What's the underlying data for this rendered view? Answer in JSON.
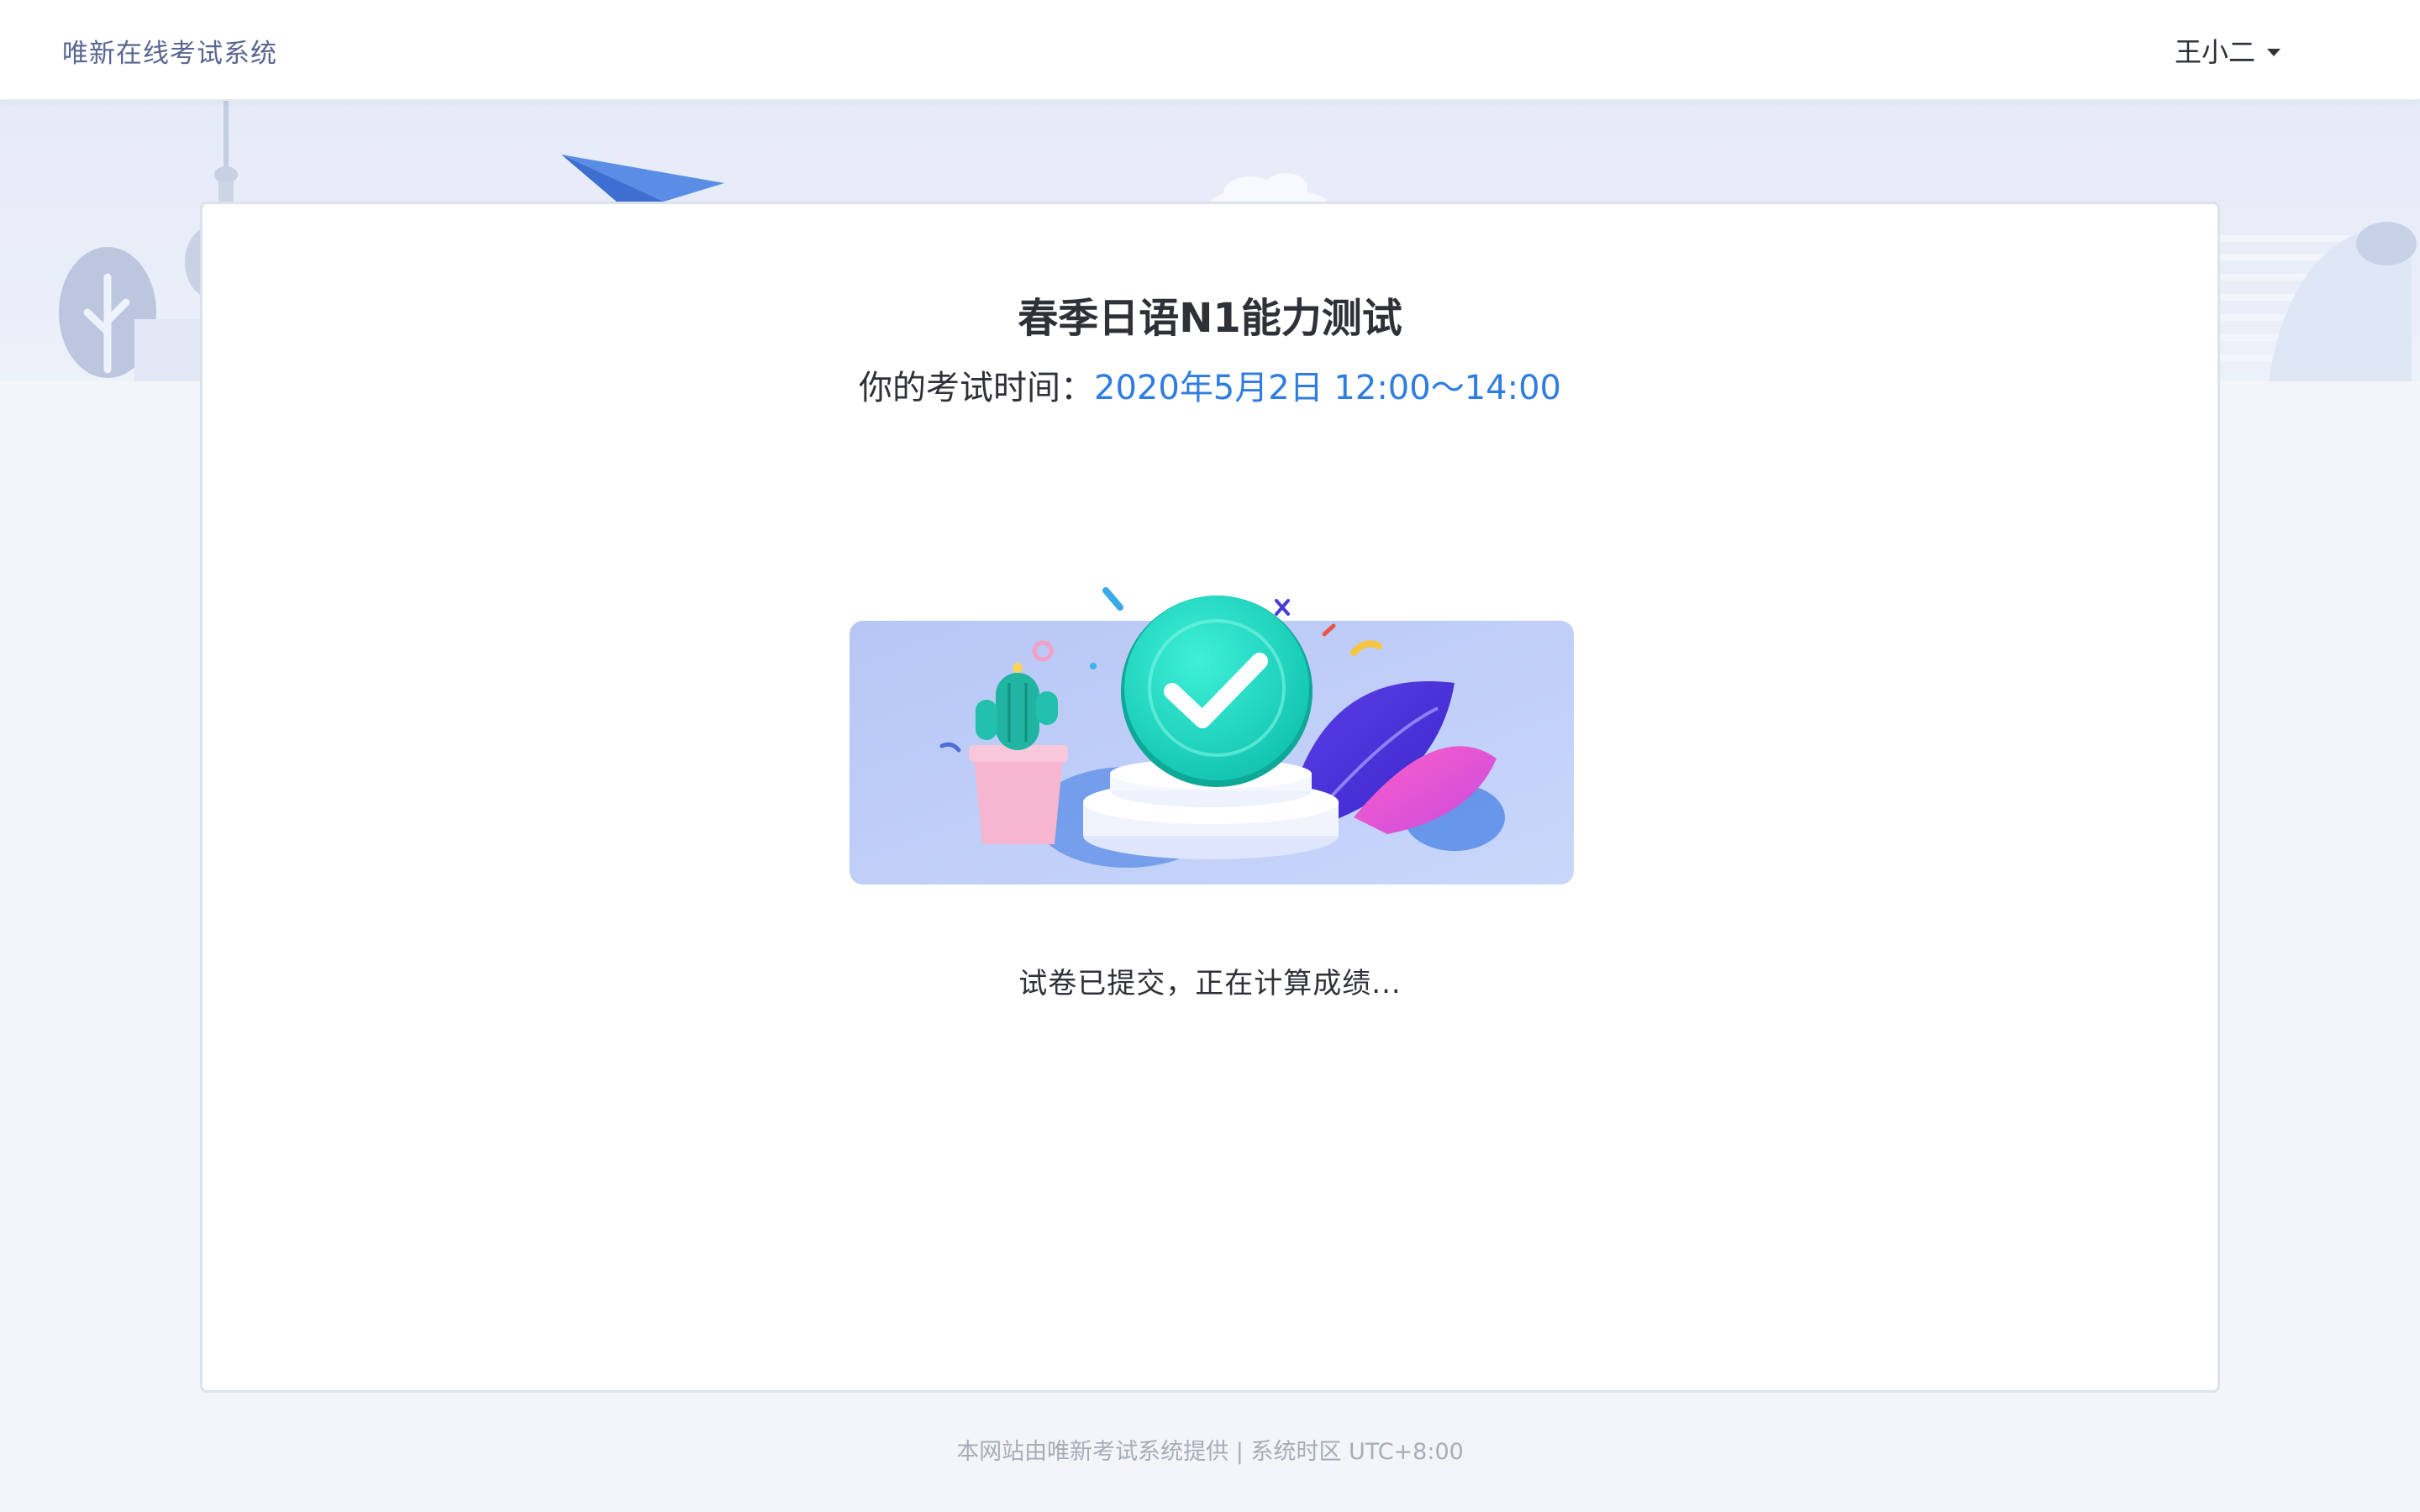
{
  "header": {
    "brand": "唯新在线考试系统",
    "user_name": "王小二",
    "user_menu_icon": "caret-down-icon"
  },
  "exam": {
    "title": "春季日语N1能力测试",
    "time_label": "你的考试时间：",
    "time_value": "2020年5月2日 12:00～14:00"
  },
  "status": {
    "message": "试卷已提交，正在计算成绩..."
  },
  "illustration": {
    "icon": "check-circle-icon"
  },
  "footer": {
    "text": "本网站由唯新考试系统提供 | 系统时区 UTC+8:00"
  },
  "colors": {
    "accent": "#2f7de1",
    "success": "#1fd6c0",
    "brand_text": "#5a6592",
    "background": "#f3f5f9"
  }
}
